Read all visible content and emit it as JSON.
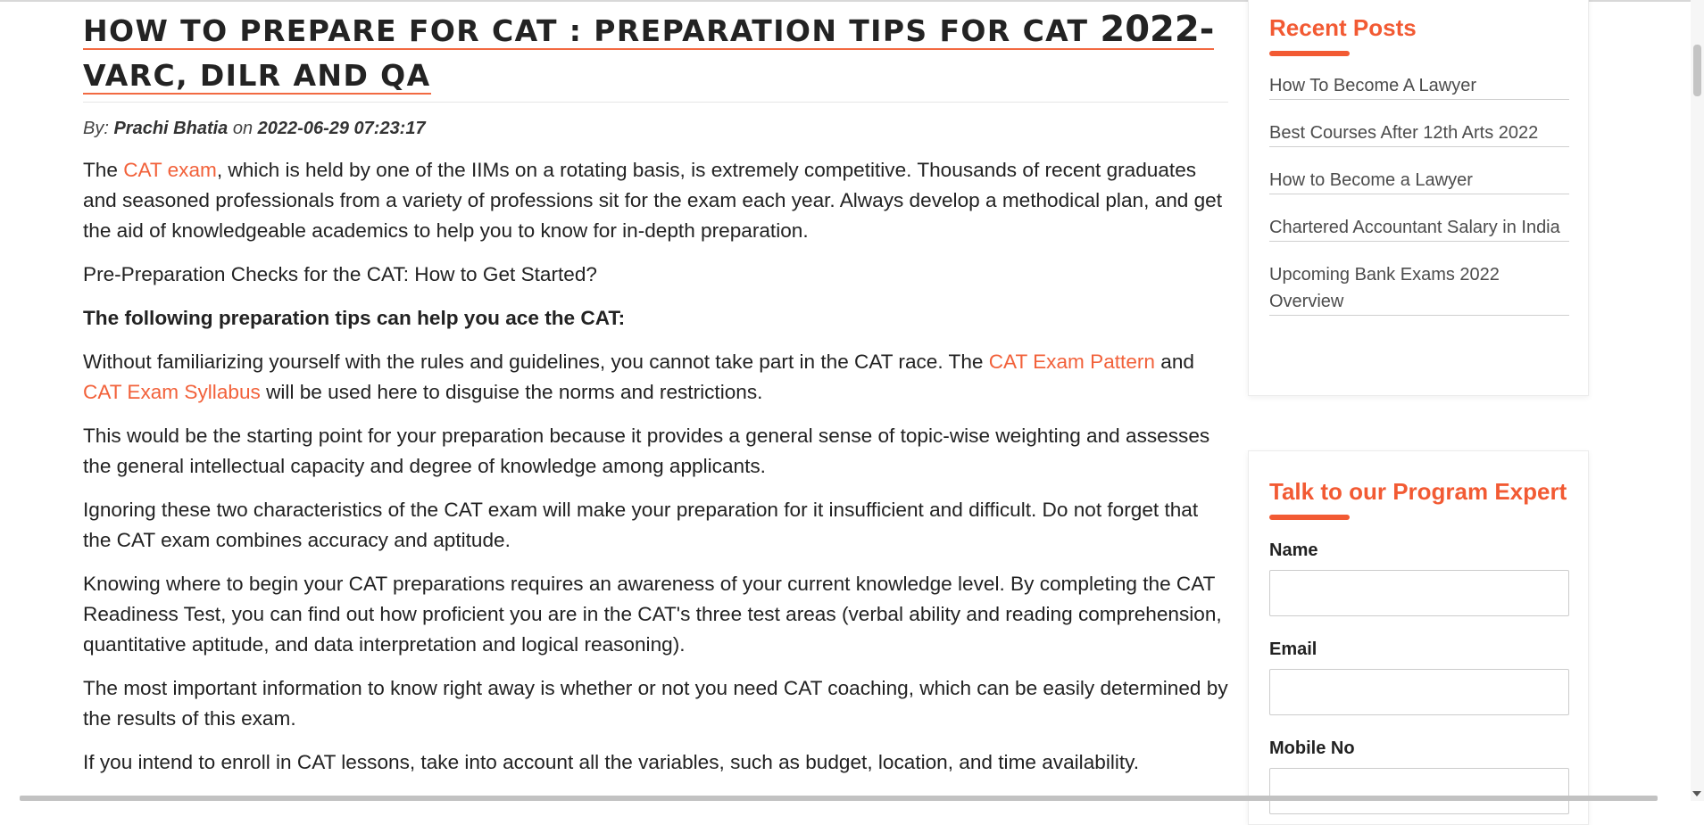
{
  "article": {
    "title_main": "HOW TO PREPARE FOR CAT : PREPARATION TIPS FOR CAT ",
    "title_year": "2022-",
    "title_line2": "VARC, DILR AND QA",
    "byline": {
      "by": "By:",
      "author": "Prachi Bhatia",
      "on": "on",
      "date": "2022-06-29 07:23:17"
    },
    "p1": {
      "before": "The ",
      "link": "CAT exam",
      "after": ", which is held by one of the IIMs on a rotating basis, is extremely competitive. Thousands of recent graduates and seasoned professionals from a variety of professions sit for the exam each year. Always develop a methodical plan, and get the aid of knowledgeable academics to help you to know for in-depth preparation."
    },
    "p2": "Pre-Preparation Checks for the CAT: How to Get Started?",
    "p3": "The following preparation tips can help you ace the CAT:",
    "p4": {
      "before": "Without familiarizing yourself with the rules and guidelines, you cannot take part in the CAT race. The ",
      "link1": "CAT Exam Pattern",
      "middle": " and ",
      "link2": "CAT Exam Syllabus",
      "after": " will be used here to disguise the norms and restrictions."
    },
    "p5": "This would be the starting point for your preparation because it provides a general sense of topic-wise weighting and assesses the general intellectual capacity and degree of knowledge among applicants.",
    "p6": "Ignoring these two characteristics of the CAT exam will make your preparation for it insufficient and difficult. Do not forget that the CAT exam combines accuracy and aptitude.",
    "p7": "Knowing where to begin your CAT preparations requires an awareness of your current knowledge level. By completing the CAT Readiness Test, you can find out how proficient you are in the CAT's three test areas (verbal ability and reading comprehension, quantitative aptitude, and data interpretation and logical reasoning).",
    "p8": "The most important information to know right away is whether or not you need CAT coaching, which can be easily determined by the results of this exam.",
    "p9": "If you intend to enroll in CAT lessons, take into account all the variables, such as budget, location, and time availability."
  },
  "sidebar": {
    "recent": {
      "title": "Recent Posts",
      "items": [
        "How To Become A Lawyer",
        "Best Courses After 12th Arts 2022",
        "How to Become a Lawyer",
        "Chartered Accountant Salary in India",
        "Upcoming Bank Exams 2022 Overview"
      ]
    },
    "expert": {
      "title": "Talk to our Program Expert",
      "name_label": "Name",
      "email_label": "Email",
      "mobile_label": "Mobile No"
    }
  },
  "colors": {
    "accent": "#f25a33",
    "link": "#f2613a",
    "text": "#222222"
  }
}
